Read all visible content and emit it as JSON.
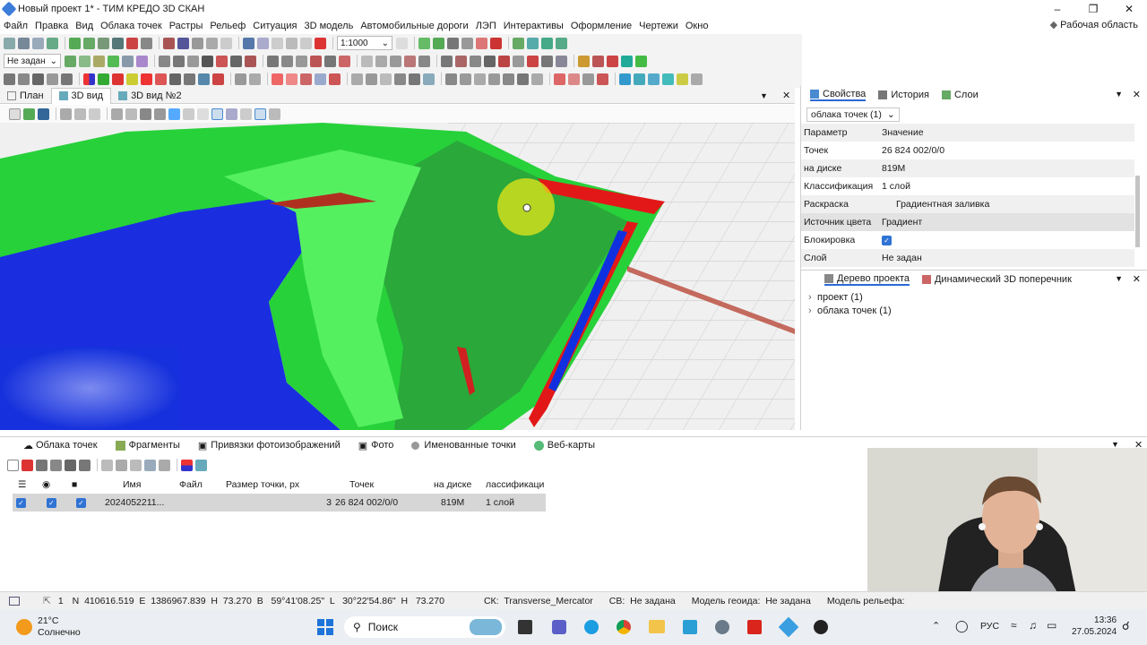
{
  "window": {
    "title": "Новый проект 1* - ТИМ КРЕДО 3D СКАН",
    "workspace": "Рабочая область"
  },
  "menu": [
    "Файл",
    "Правка",
    "Вид",
    "Облака точек",
    "Растры",
    "Рельеф",
    "Ситуация",
    "3D модель",
    "Автомобильные дороги",
    "ЛЭП",
    "Интерактивы",
    "Оформление",
    "Чертежи",
    "Окно"
  ],
  "toolbar": {
    "scale": "1:1000",
    "layer_combo": "Не задан"
  },
  "doc_tabs": [
    "План",
    "3D вид",
    "3D вид №2"
  ],
  "properties": {
    "tabs": [
      "Свойства",
      "История",
      "Слои"
    ],
    "object": "облака точек (1)",
    "header": {
      "param": "Параметр",
      "value": "Значение"
    },
    "rows": [
      {
        "k": "Точек",
        "v": "26 824 002/0/0"
      },
      {
        "k": "на диске",
        "v": "819M"
      },
      {
        "k": "Классификация",
        "v": "1 слой"
      },
      {
        "k": "Раскраска",
        "v": "Градиентная заливка"
      },
      {
        "k": "Источник цвета",
        "v": "Градиент"
      },
      {
        "k": "Блокировка",
        "v": ""
      },
      {
        "k": "Слой",
        "v": "Не задан"
      }
    ]
  },
  "tree": {
    "tabs": [
      "Дерево проекта",
      "Динамический 3D поперечник"
    ],
    "items": [
      "проект (1)",
      "облака точек (1)"
    ]
  },
  "bottom": {
    "tabs": [
      "Облака точек",
      "Фрагменты",
      "Привязки фотоизображений",
      "Фото",
      "Именованные точки",
      "Веб-карты"
    ],
    "columns": [
      "Имя",
      "Файл",
      "Размер точки, px",
      "Точек",
      "на диске",
      "лассификаци"
    ],
    "row": {
      "name": "2024052211...",
      "file": "",
      "size": "3",
      "points": "26 824 002/0/0",
      "disk": "819M",
      "class": "1 слой"
    }
  },
  "status": {
    "n": "1",
    "coords": "N  410616.519  E  1386967.839  H  73.270  B   59°41'08.25\"  L   30°22'54.86\"  H   73.270",
    "sk": "СК:  Transverse_Mercator",
    "sv": "СВ:  Не задана",
    "geoid": "Модель геоида:  Не задана",
    "relief": "Модель рельефа:"
  },
  "taskbar": {
    "temp": "21°C",
    "weather": "Солнечно",
    "search": "Поиск",
    "lang": "РУС",
    "time": "13:36",
    "date": "27.05.2024"
  },
  "colors": {
    "accent": "#2a6ad6",
    "ground": "#2ec832",
    "water": "#1033d8",
    "edge": "#e01010"
  }
}
